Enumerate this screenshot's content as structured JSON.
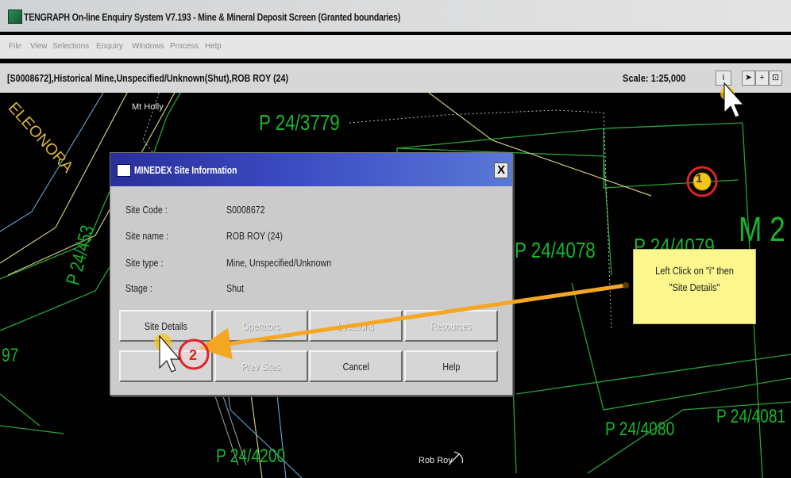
{
  "window": {
    "title": "TENGRAPH On-line Enquiry System V7.193 - Mine & Mineral Deposit Screen (Granted boundaries)"
  },
  "menu": {
    "items": [
      "File",
      "View",
      "Selections",
      "Enquiry",
      "Windows",
      "Process",
      "Help"
    ]
  },
  "status": {
    "text": "[S0008672],Historical Mine,Unspecified/Unknown(Shut),ROB ROY (24)",
    "scale": "Scale: 1:25,000"
  },
  "toolbar": {
    "icons": [
      "info-icon",
      "pointer-icon",
      "crosshair-icon",
      "select-icon"
    ],
    "info_label": "i",
    "pointer_label": "➤",
    "crosshair_label": "+",
    "select_label": "⊡"
  },
  "map": {
    "labels": {
      "eleonora": "ELEONORA",
      "mt_holly": "Mt Holly",
      "p3779": "P 24/3779",
      "p4078": "P 24/4078",
      "p4079": "P 24/4079",
      "p2453": "P 24/453",
      "m_big": "M 2",
      "p4080": "P 24/4080",
      "p4081": "P 24/4081",
      "p4200": "P 24/4200",
      "rob_roy": "Rob Roy",
      "edge_97": "97"
    }
  },
  "dialog": {
    "title": "MINEDEX Site Information",
    "close": "X",
    "fields": [
      {
        "label": "Site Code :",
        "value": "S0008672"
      },
      {
        "label": "Site name :",
        "value": "ROB ROY (24)"
      },
      {
        "label": "Site type :",
        "value": "Mine, Unspecified/Unknown"
      },
      {
        "label": "Stage :",
        "value": "Shut"
      }
    ],
    "buttons": {
      "site_details": "Site Details",
      "operators": "Operators",
      "locations": "Locations",
      "resources": "Resources",
      "blank": "",
      "prev_sites": "Prev Sites",
      "cancel": "Cancel",
      "help": "Help"
    }
  },
  "annotation": {
    "callout_line1": "Left Click on \"i\" then",
    "callout_line2": "\"Site Details\"",
    "step1": "1",
    "step2": "2",
    "accent": "#f5a623",
    "marker_color": "#e0232a"
  }
}
